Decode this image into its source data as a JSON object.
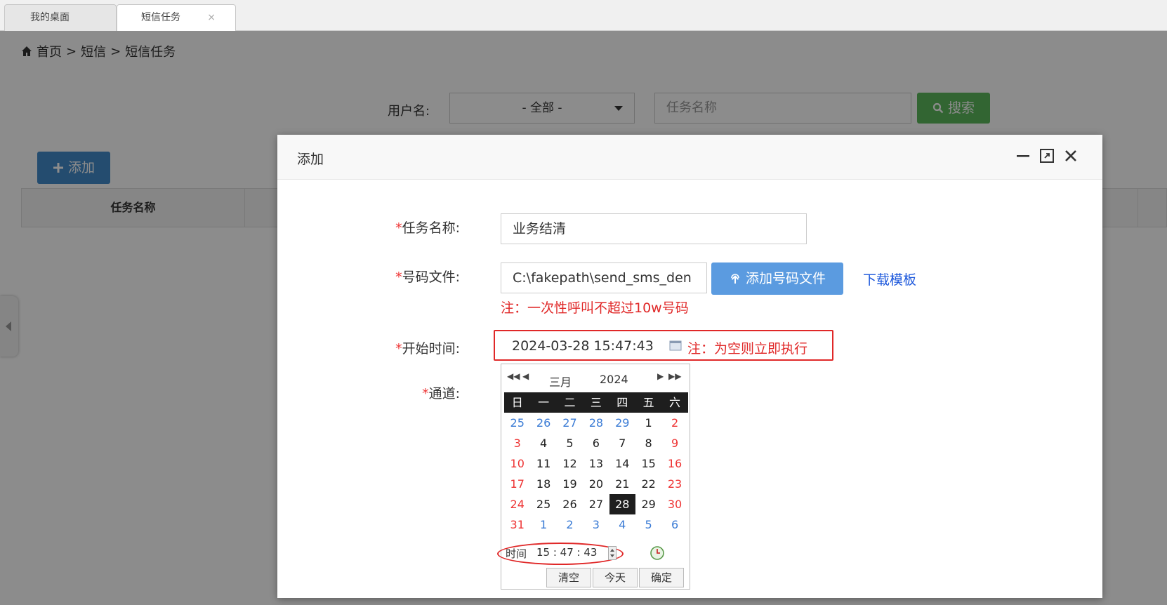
{
  "tabs": [
    {
      "label": "我的桌面"
    },
    {
      "label": "短信任务",
      "close": "×"
    }
  ],
  "breadcrumb": {
    "home": "首页",
    "sep1": ">",
    "item1": "短信",
    "sep2": ">",
    "item2": "短信任务"
  },
  "filter": {
    "username_label": "用户名:",
    "username_value": "- 全部 -",
    "task_placeholder": "任务名称",
    "search_label": "搜索"
  },
  "add_button": "添加",
  "table": {
    "col_task_name": "任务名称"
  },
  "dialog": {
    "title": "添加",
    "task_name_label": "任务名称:",
    "task_name_value": "业务结清",
    "file_label": "号码文件:",
    "file_value": "C:\\fakepath\\send_sms_den",
    "upload_button": "添加号码文件",
    "download_link": "下载模板",
    "file_note": "注：一次性呼叫不超过10w号码",
    "start_label": "开始时间:",
    "start_value": "2024-03-28 15:47:43",
    "start_note": "注：为空则立即执行",
    "channel_label": "通道:",
    "required_mark": "*"
  },
  "calendar": {
    "month": "三月",
    "year": "2024",
    "weekdays": [
      "日",
      "一",
      "二",
      "三",
      "四",
      "五",
      "六"
    ],
    "weeks": [
      [
        "25",
        "26",
        "27",
        "28",
        "29",
        "1",
        "2"
      ],
      [
        "3",
        "4",
        "5",
        "6",
        "7",
        "8",
        "9"
      ],
      [
        "10",
        "11",
        "12",
        "13",
        "14",
        "15",
        "16"
      ],
      [
        "17",
        "18",
        "19",
        "20",
        "21",
        "22",
        "23"
      ],
      [
        "24",
        "25",
        "26",
        "27",
        "28",
        "29",
        "30"
      ],
      [
        "31",
        "1",
        "2",
        "3",
        "4",
        "5",
        "6"
      ]
    ],
    "selected_day": "28",
    "time_label": "时间",
    "time_value": "15 : 47 : 43",
    "buttons": {
      "clear": "清空",
      "today": "今天",
      "ok": "确定"
    }
  },
  "colors": {
    "accent_red": "#e02828",
    "primary_blue": "#428bca",
    "success_green": "#5cb85c"
  }
}
